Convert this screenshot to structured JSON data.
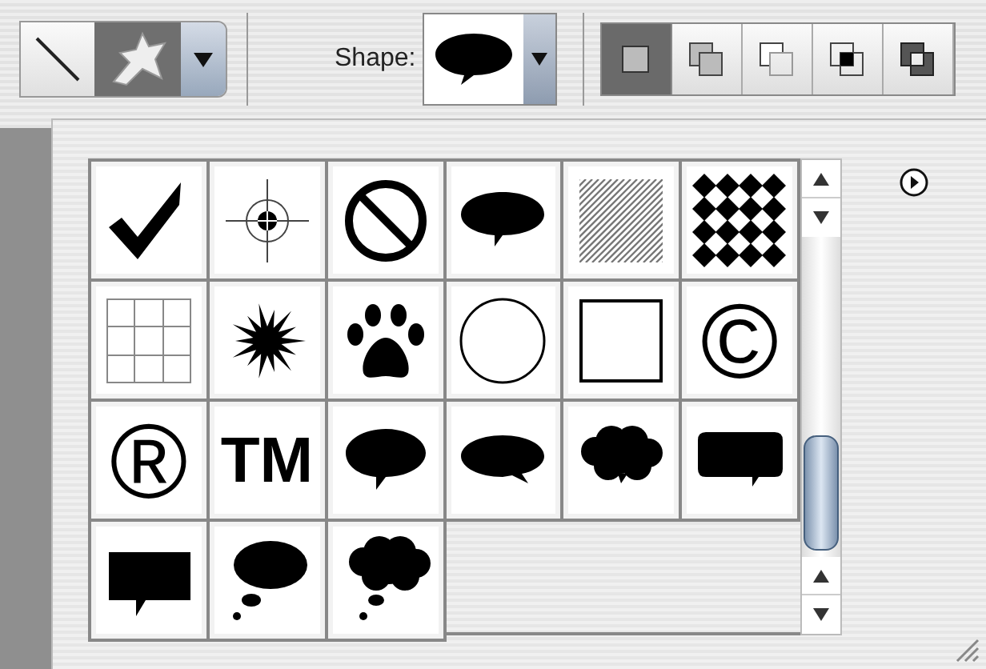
{
  "toolbar": {
    "tools": [
      {
        "kind": "line",
        "selected": false
      },
      {
        "kind": "custom-shape",
        "selected": true
      }
    ],
    "shape_label": "Shape:",
    "modes": [
      {
        "kind": "new",
        "selected": true
      },
      {
        "kind": "add",
        "selected": false
      },
      {
        "kind": "subtract",
        "selected": false
      },
      {
        "kind": "intersect",
        "selected": false
      },
      {
        "kind": "exclude",
        "selected": false
      }
    ]
  },
  "shapes": [
    {
      "kind": "checkmark"
    },
    {
      "kind": "target"
    },
    {
      "kind": "prohibited"
    },
    {
      "kind": "oval-bubble"
    },
    {
      "kind": "hatch"
    },
    {
      "kind": "diamonds"
    },
    {
      "kind": "grid"
    },
    {
      "kind": "starburst"
    },
    {
      "kind": "paw"
    },
    {
      "kind": "circle"
    },
    {
      "kind": "square"
    },
    {
      "kind": "symbol",
      "label": "©"
    },
    {
      "kind": "symbol",
      "label": "®"
    },
    {
      "kind": "symbol",
      "label": "TM"
    },
    {
      "kind": "round-bubble"
    },
    {
      "kind": "oval-bubble-right"
    },
    {
      "kind": "cloud-bubble"
    },
    {
      "kind": "rounded-rect-bubble"
    },
    {
      "kind": "rect-bubble"
    },
    {
      "kind": "thought-oval"
    },
    {
      "kind": "thought-cloud"
    }
  ]
}
